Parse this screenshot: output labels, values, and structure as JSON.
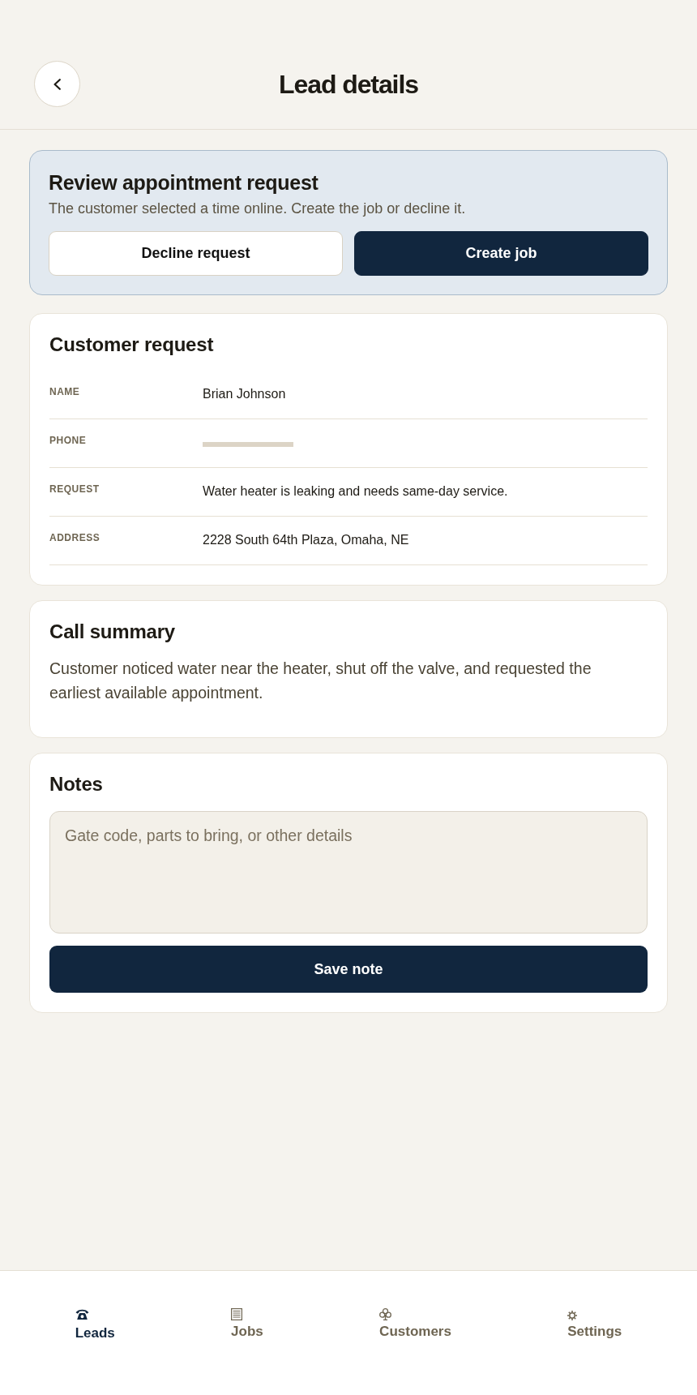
{
  "header": {
    "title": "Lead details"
  },
  "review_banner": {
    "title": "Review appointment request",
    "message": "The customer selected a time online. Create the job or decline it.",
    "buttons": [
      {
        "label": "Decline request",
        "kind": "secondary"
      },
      {
        "label": "Create job",
        "kind": "primary"
      }
    ]
  },
  "customer_request": {
    "title": "Customer request",
    "fields": [
      {
        "label": "NAME",
        "kind": "text",
        "value": "Brian Johnson"
      },
      {
        "label": "PHONE",
        "kind": "redacted"
      },
      {
        "label": "REQUEST",
        "kind": "text",
        "value": "Water heater is leaking and needs same-day service."
      },
      {
        "label": "ADDRESS",
        "kind": "text",
        "value": "2228 South 64th Plaza, Omaha, NE"
      }
    ]
  },
  "call_summary": {
    "title": "Call summary",
    "text": "Customer noticed water near the heater, shut off the valve, and requested the earliest available appointment."
  },
  "notes": {
    "title": "Notes",
    "placeholder": "Gate code, parts to bring, or other details",
    "button": {
      "label": "Save note"
    }
  },
  "bottom_nav": {
    "items": [
      {
        "label": "Leads",
        "selected": true
      },
      {
        "label": "Jobs",
        "selected": false
      },
      {
        "label": "Customers",
        "selected": false
      },
      {
        "label": "Settings",
        "selected": false
      }
    ]
  }
}
